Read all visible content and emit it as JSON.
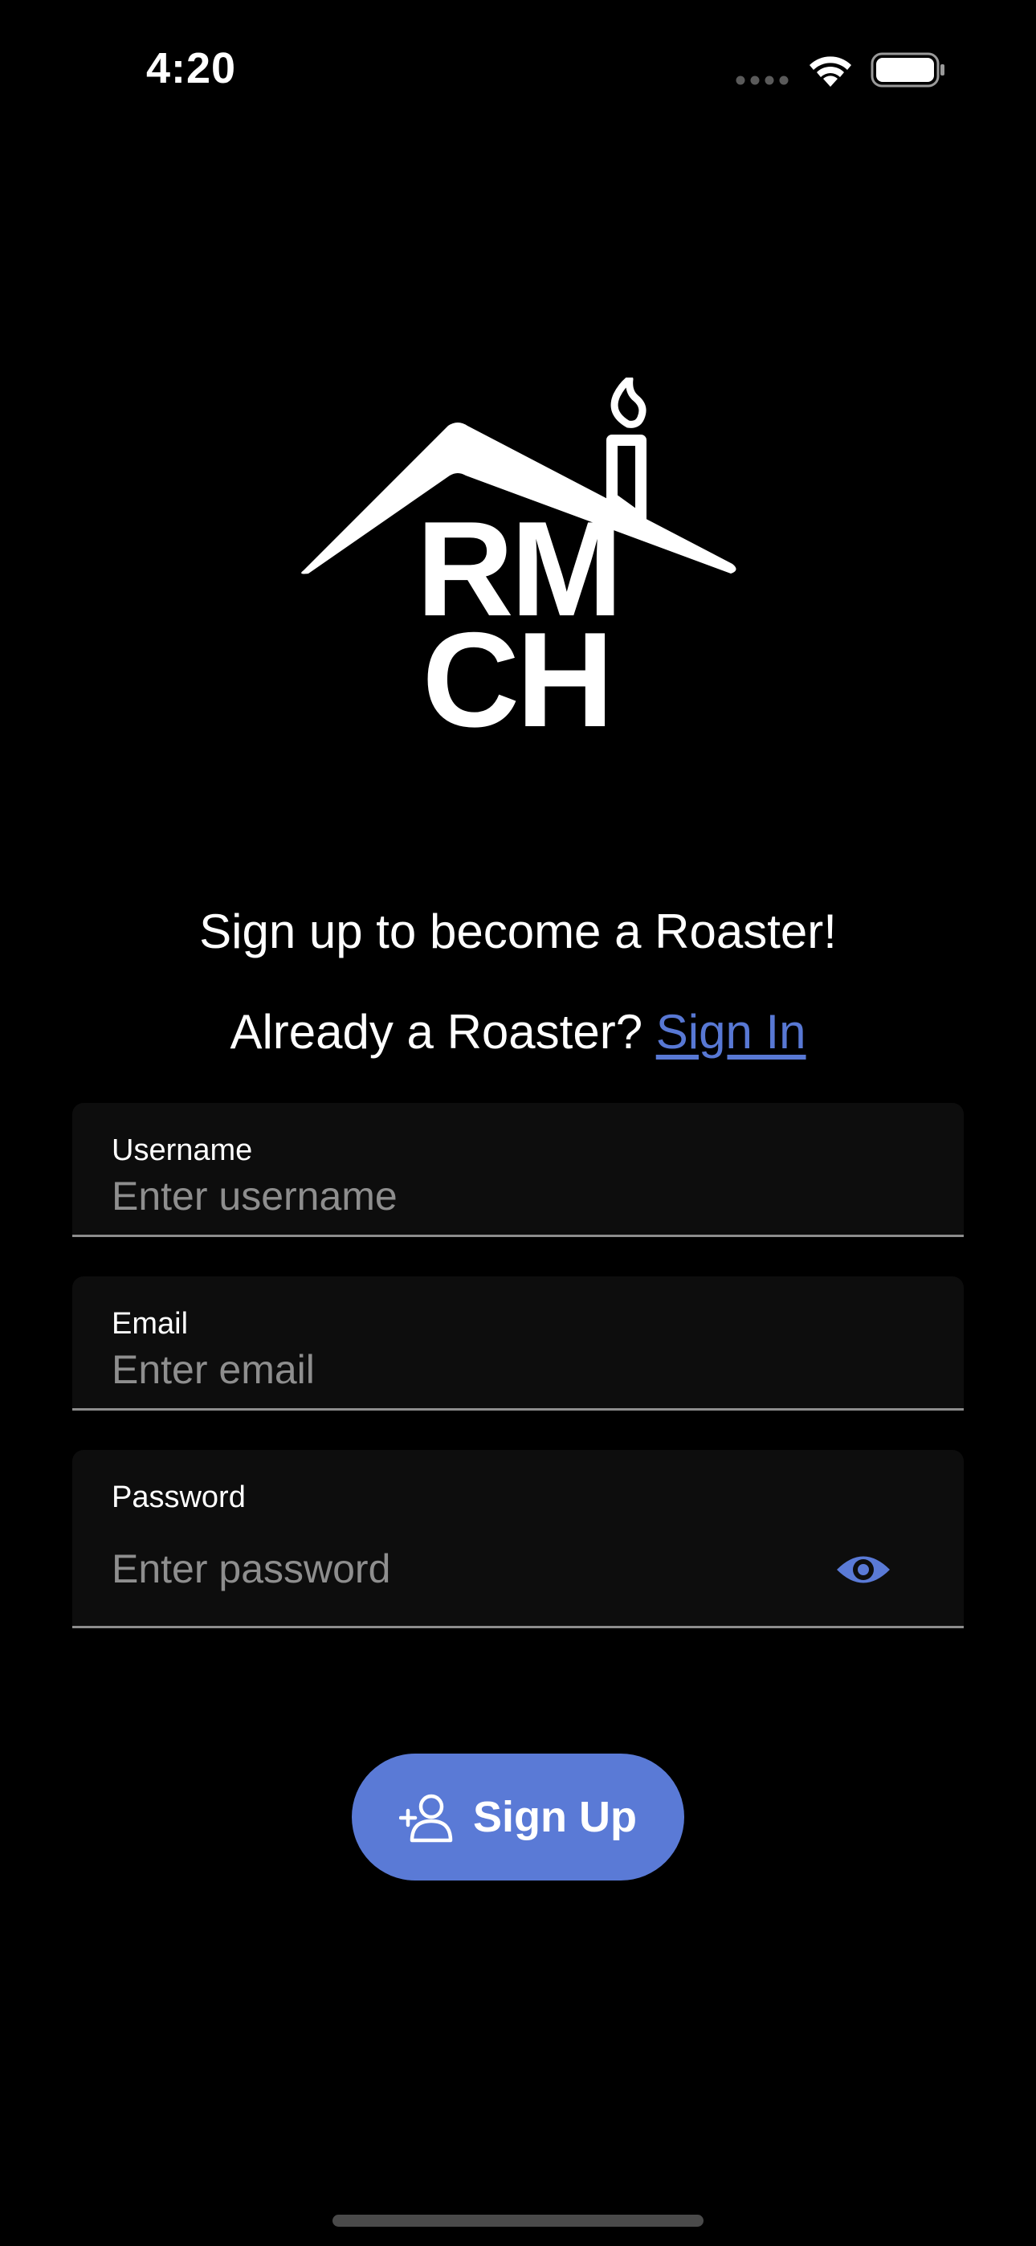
{
  "status_bar": {
    "time": "4:20",
    "icons": [
      "signal-icon",
      "wifi-icon",
      "battery-icon"
    ]
  },
  "logo": {
    "line1": "RM",
    "line2": "CH"
  },
  "headline": "Sign up to become a Roaster!",
  "signin_prompt": {
    "text": "Already a Roaster? ",
    "link_label": "Sign In"
  },
  "form": {
    "username": {
      "label": "Username",
      "placeholder": "Enter username",
      "value": ""
    },
    "email": {
      "label": "Email",
      "placeholder": "Enter email",
      "value": ""
    },
    "password": {
      "label": "Password",
      "placeholder": "Enter password",
      "value": "",
      "toggle_icon": "eye-icon"
    }
  },
  "signup_button": {
    "label": "Sign Up",
    "icon": "add-user-icon"
  },
  "colors": {
    "background": "#000000",
    "accent": "#5a7ad6",
    "link": "#5878d4",
    "field_background": "#0d0d0d",
    "placeholder": "#8e8e8e"
  }
}
